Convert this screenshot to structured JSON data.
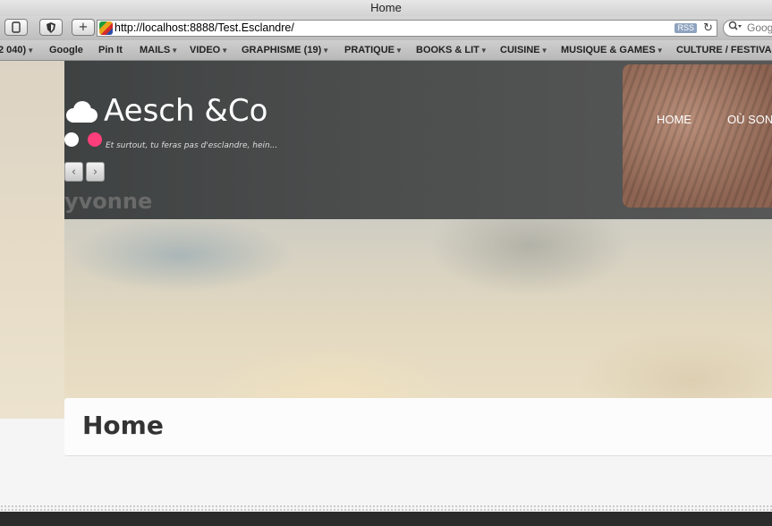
{
  "window": {
    "title": "Home"
  },
  "toolbar": {
    "back_icon": "document-icon",
    "share_icon": "shield-icon",
    "add_label": "+",
    "url": "http://localhost:8888/Test.Esclandre/",
    "rss_label": "RSS",
    "reload_glyph": "↻",
    "search_placeholder": "Goog"
  },
  "bookmarks": [
    {
      "label": "2 040)",
      "has_arrow": true
    },
    {
      "label": "Google",
      "has_arrow": false
    },
    {
      "label": "Pin It",
      "has_arrow": false
    },
    {
      "label": "MAILS",
      "has_arrow": true
    },
    {
      "label": "VIDEO",
      "has_arrow": true
    },
    {
      "label": "GRAPHISME (19)",
      "has_arrow": true
    },
    {
      "label": "PRATIQUE",
      "has_arrow": true
    },
    {
      "label": "BOOKS & LIT",
      "has_arrow": true
    },
    {
      "label": "CUISINE",
      "has_arrow": true
    },
    {
      "label": "MUSIQUE & GAMES",
      "has_arrow": true
    },
    {
      "label": "CULTURE / FESTIVA",
      "has_arrow": false
    }
  ],
  "site": {
    "title": "Aesch &Co",
    "tagline": "Et surtout, tu feras pas d'esclandre, hein...",
    "slide_name": "yvonne",
    "prev_glyph": "‹",
    "next_glyph": "›",
    "nav": {
      "home": "HOME",
      "ou": "OÙ SON"
    },
    "accent_colors": {
      "dot_white": "#ffffff",
      "dot_pink": "#ff3f7b"
    }
  },
  "page": {
    "title": "Home"
  }
}
